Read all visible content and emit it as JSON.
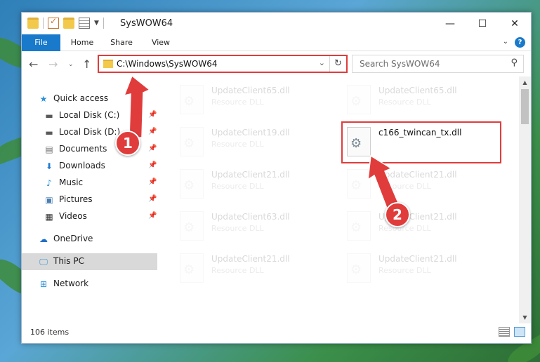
{
  "window": {
    "title": "SysWOW64",
    "controls": {
      "minimize": "—",
      "maximize": "☐",
      "close": "✕"
    }
  },
  "ribbon": {
    "tabs": [
      "File",
      "Home",
      "Share",
      "View"
    ],
    "help": "?"
  },
  "nav": {
    "back": "←",
    "forward": "→",
    "recent": "⌄",
    "up": "↑",
    "address": "C:\\Windows\\SysWOW64",
    "dropdown": "⌄",
    "refresh": "↻",
    "search_placeholder": "Search SysWOW64",
    "search_icon": "⚲"
  },
  "sidebar": {
    "items": [
      {
        "label": "Quick access",
        "icon": "star-icon",
        "glyph": "★",
        "color": "#2b8fd6"
      },
      {
        "label": "Local Disk (C:)",
        "icon": "drive-icon",
        "glyph": "▬",
        "color": "#5a5a5a",
        "pinned": true
      },
      {
        "label": "Local Disk (D:)",
        "icon": "drive-icon",
        "glyph": "▬",
        "color": "#5a5a5a",
        "pinned": true
      },
      {
        "label": "Documents",
        "icon": "documents-icon",
        "glyph": "▤",
        "color": "#6e6e6e",
        "pinned": true
      },
      {
        "label": "Downloads",
        "icon": "download-icon",
        "glyph": "⬇",
        "color": "#1f7ad1",
        "pinned": true
      },
      {
        "label": "Music",
        "icon": "music-icon",
        "glyph": "♪",
        "color": "#2b8fd6",
        "pinned": true
      },
      {
        "label": "Pictures",
        "icon": "pictures-icon",
        "glyph": "▣",
        "color": "#4a7fb0",
        "pinned": true
      },
      {
        "label": "Videos",
        "icon": "videos-icon",
        "glyph": "▦",
        "color": "#333333",
        "pinned": true
      },
      {
        "label": "OneDrive",
        "icon": "cloud-icon",
        "glyph": "☁",
        "color": "#1f6fc7"
      },
      {
        "label": "This PC",
        "icon": "computer-icon",
        "glyph": "🖵",
        "color": "#2b8fd6",
        "selected": true
      },
      {
        "label": "Network",
        "icon": "network-icon",
        "glyph": "⊞",
        "color": "#2b8fd6"
      }
    ],
    "pin_glyph": "📌"
  },
  "files": {
    "left_column": [
      {
        "name": "UpdateClient65.dll",
        "type": "Resource DLL"
      },
      {
        "name": "UpdateClient19.dll",
        "type": "Resource DLL"
      },
      {
        "name": "UpdateClient21.dll",
        "type": "Resource DLL"
      },
      {
        "name": "UpdateClient63.dll",
        "type": "Resource DLL"
      },
      {
        "name": "UpdateClient21.dll",
        "type": "Resource DLL"
      }
    ],
    "right_column": [
      {
        "name": "UpdateClient65.dll",
        "type": "Resource DLL"
      },
      {
        "name": "c166_twincan_tx.dll",
        "type": "",
        "highlighted": true
      },
      {
        "name": "UpdateClient21.dll",
        "type": "Resource DLL"
      },
      {
        "name": "UpdateClient21.dll",
        "type": "Resource DLL"
      },
      {
        "name": "UpdateClient21.dll",
        "type": "Resource DLL"
      }
    ]
  },
  "status": {
    "item_count": "106 items"
  },
  "annotations": {
    "step1": "1",
    "step2": "2",
    "color": "#e03c3c"
  }
}
